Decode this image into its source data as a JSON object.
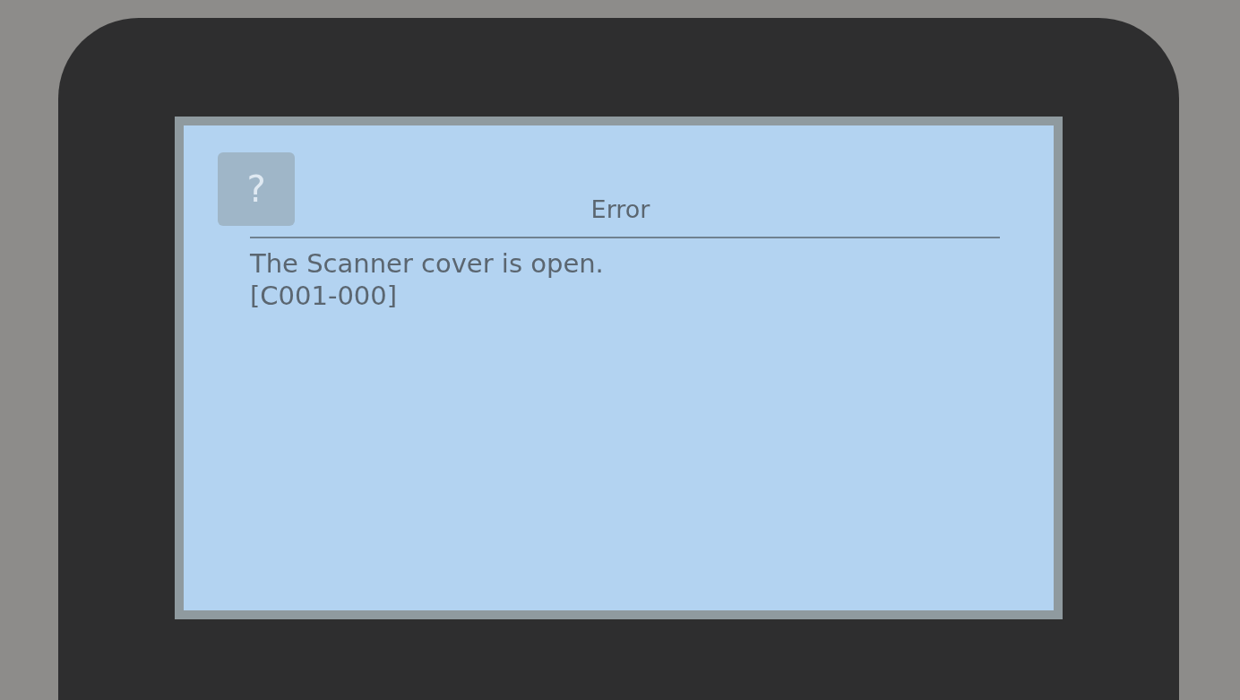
{
  "help_button": {
    "label": "?"
  },
  "dialog": {
    "title": "Error",
    "message_lines": [
      "The Scanner cover is open.",
      "[C001-000]"
    ]
  }
}
